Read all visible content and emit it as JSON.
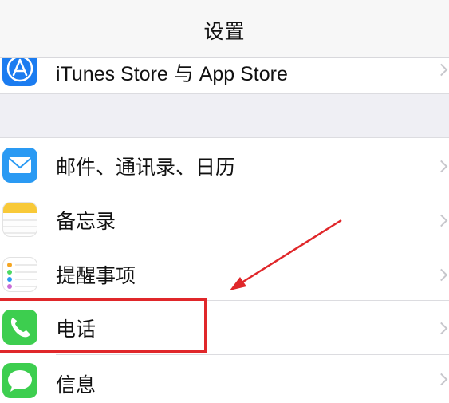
{
  "nav": {
    "title": "设置"
  },
  "rows": [
    {
      "label": "iTunes Store 与 App Store",
      "icon": "app-store-icon"
    },
    {
      "label": "邮件、通讯录、日历",
      "icon": "mail-icon"
    },
    {
      "label": "备忘录",
      "icon": "notes-icon"
    },
    {
      "label": "提醒事项",
      "icon": "reminders-icon"
    },
    {
      "label": "电话",
      "icon": "phone-icon"
    },
    {
      "label": "信息",
      "icon": "messages-icon"
    }
  ],
  "annotation": {
    "highlight_color": "#e0272a",
    "target": "电话"
  }
}
